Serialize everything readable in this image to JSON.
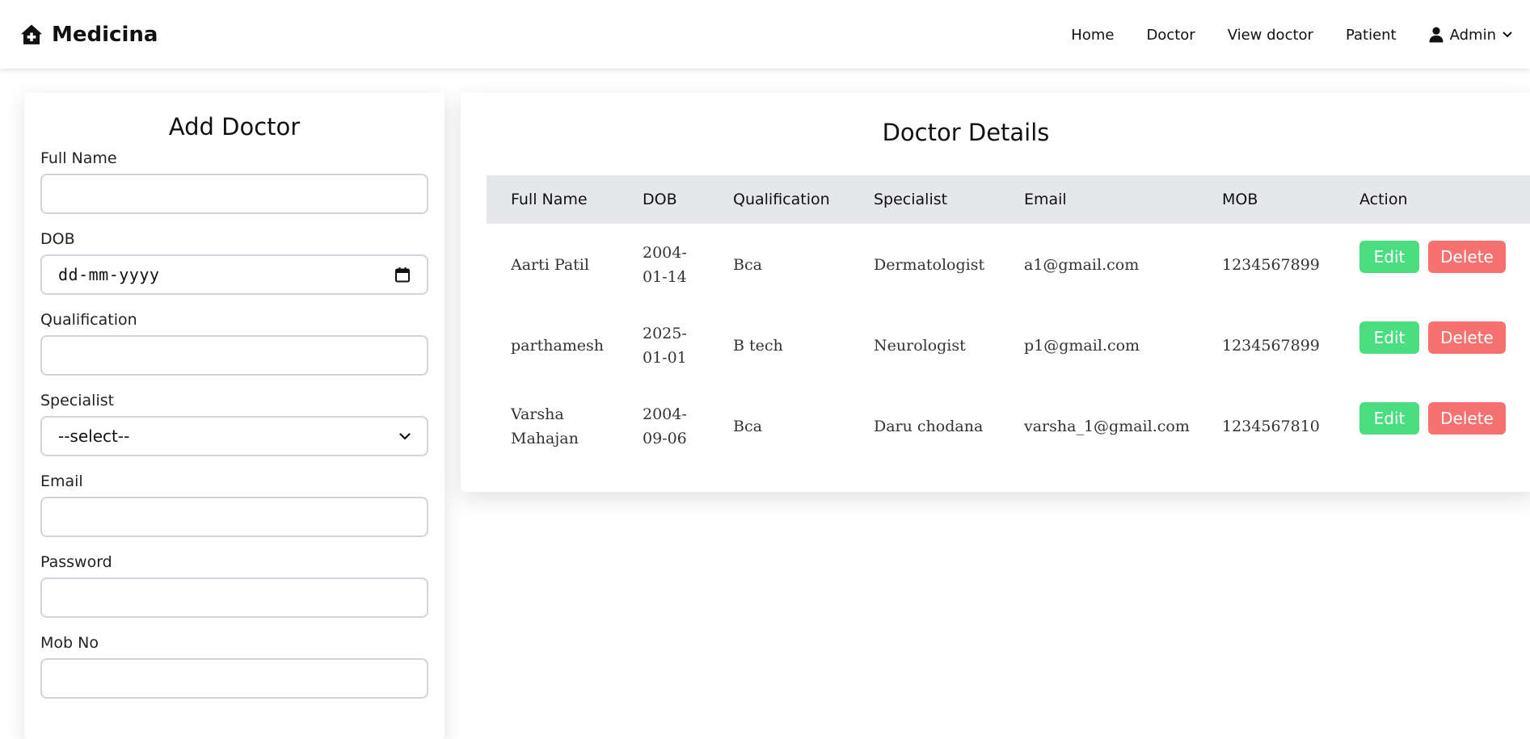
{
  "brand": {
    "name": "Medicina"
  },
  "nav": {
    "links": [
      "Home",
      "Doctor",
      "View doctor",
      "Patient"
    ],
    "admin_label": "Admin"
  },
  "form": {
    "title": "Add Doctor",
    "fields": {
      "full_name": {
        "label": "Full Name",
        "value": ""
      },
      "dob": {
        "label": "DOB",
        "placeholder": "dd-mm-yyyy"
      },
      "qualification": {
        "label": "Qualification",
        "value": ""
      },
      "specialist": {
        "label": "Specialist",
        "selected": "--select--"
      },
      "email": {
        "label": "Email",
        "value": ""
      },
      "password": {
        "label": "Password",
        "value": ""
      },
      "mob": {
        "label": "Mob No",
        "value": ""
      }
    }
  },
  "table": {
    "title": "Doctor Details",
    "headers": [
      "Full Name",
      "DOB",
      "Qualification",
      "Specialist",
      "Email",
      "MOB",
      "Action"
    ],
    "rows": [
      {
        "name_line1": "Aarti Patil",
        "name_line2": "",
        "dob_line1": "2004-",
        "dob_line2": "01-14",
        "qualification": "Bca",
        "specialist": "Dermatologist",
        "email": "a1@gmail.com",
        "mob": "1234567899"
      },
      {
        "name_line1": "parthamesh",
        "name_line2": "",
        "dob_line1": "2025-",
        "dob_line2": "01-01",
        "qualification": "B tech",
        "specialist": "Neurologist",
        "email": "p1@gmail.com",
        "mob": "1234567899"
      },
      {
        "name_line1": "Varsha",
        "name_line2": "Mahajan",
        "dob_line1": "2004-",
        "dob_line2": "09-06",
        "qualification": "Bca",
        "specialist": "Daru chodana",
        "email": "varsha_1@gmail.com",
        "mob": "1234567810"
      }
    ],
    "edit_label": "Edit",
    "delete_label": "Delete"
  },
  "colors": {
    "edit_button": "#4ade80",
    "delete_button": "#f87171",
    "table_header_bg": "#e5e7eb"
  }
}
